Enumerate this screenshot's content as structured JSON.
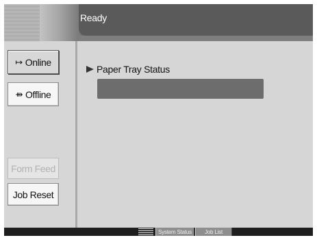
{
  "header": {
    "status": "Ready"
  },
  "left_panel": {
    "online_label": "Online",
    "offline_label": "Offline",
    "form_feed_label": "Form Feed",
    "job_reset_label": "Job Reset",
    "online_icon": "↦",
    "offline_icon": "⇻"
  },
  "main": {
    "paper_tray_label": "Paper Tray Status",
    "paper_tray_value": ""
  },
  "footer": {
    "system_status_label": "System Status",
    "job_list_label": "Job List"
  },
  "colors": {
    "header_bar": "#5a5a5a",
    "background": "#d6d6d6",
    "tray_bar": "#6d6d6d",
    "footer": "#1e1e1e"
  }
}
